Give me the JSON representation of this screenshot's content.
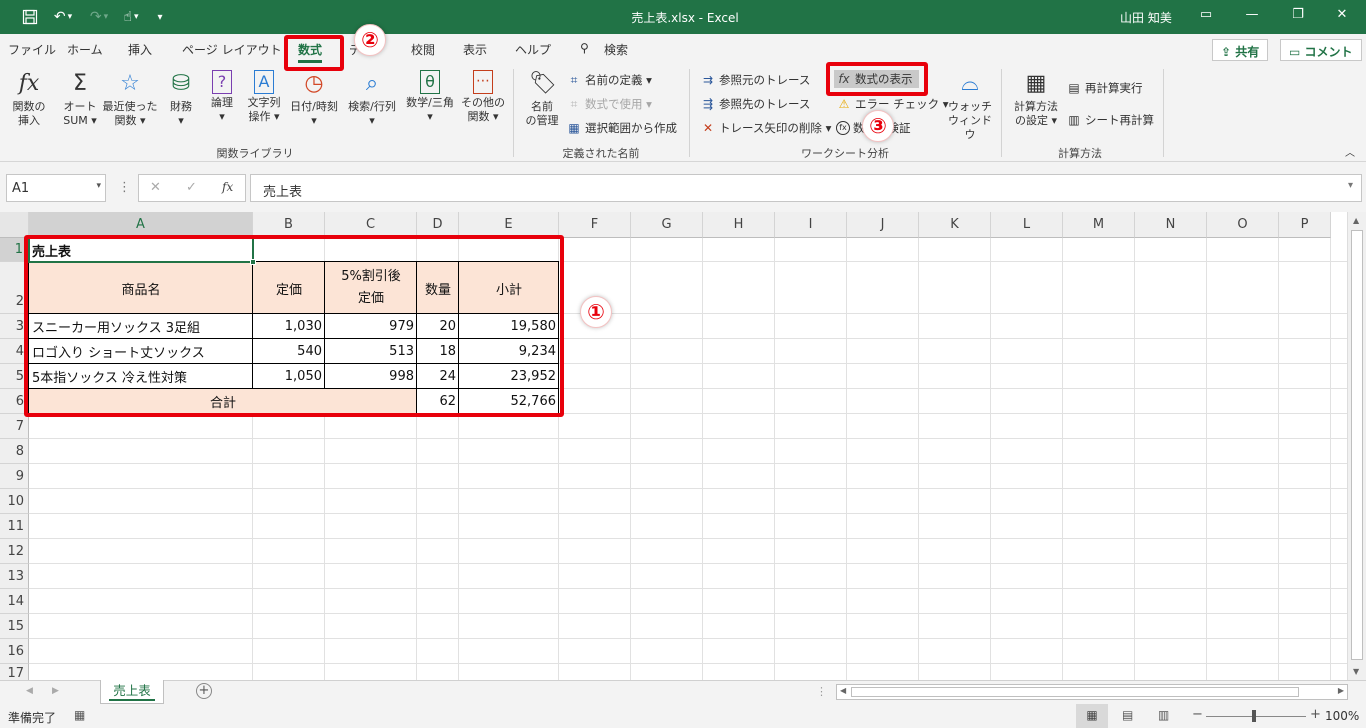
{
  "titlebar": {
    "title": "売上表.xlsx  -  Excel",
    "user": "山田 知美",
    "customize_label": "▾"
  },
  "tabs": [
    "ファイル",
    "ホーム",
    "挿入",
    "ページ レイアウト",
    "数式",
    "データ",
    "校閲",
    "表示",
    "ヘルプ",
    "検索"
  ],
  "active_tab": "数式",
  "share_label": "共有",
  "comment_label": "コメント",
  "badges": [
    "①",
    "②",
    "③"
  ],
  "ribbon": {
    "function_library": {
      "label": "関数ライブラリ",
      "items": [
        {
          "line1": "関数の",
          "line2": "挿入",
          "icon": "fx-icon"
        },
        {
          "line1": "オート",
          "line2": "SUM ▾",
          "icon": "sigma-icon"
        },
        {
          "line1": "最近使った",
          "line2": "関数 ▾",
          "icon": "star-icon"
        },
        {
          "line1": "財務",
          "line2": "▾",
          "icon": "finance-icon"
        },
        {
          "line1": "論理",
          "line2": "▾",
          "icon": "logic-icon"
        },
        {
          "line1": "文字列",
          "line2": "操作 ▾",
          "icon": "text-icon"
        },
        {
          "line1": "日付/時刻",
          "line2": "▾",
          "icon": "clock-icon"
        },
        {
          "line1": "検索/行列",
          "line2": "▾",
          "icon": "lookup-icon"
        },
        {
          "line1": "数学/三角",
          "line2": "▾",
          "icon": "theta-icon"
        },
        {
          "line1": "その他の",
          "line2": "関数 ▾",
          "icon": "more-functions-icon"
        }
      ]
    },
    "defined_names": {
      "label": "定義された名前",
      "name_manager_line1": "名前",
      "name_manager_line2": "の管理",
      "define_name": "名前の定義  ▾",
      "use_in_formula": "数式で使用 ▾",
      "create_from_selection": "選択範囲から作成"
    },
    "formula_auditing": {
      "label": "ワークシート分析",
      "trace_precedents": "参照元のトレース",
      "trace_dependents": "参照先のトレース",
      "remove_arrows": "トレース矢印の削除  ▾",
      "show_formulas": "数式の表示",
      "error_checking": "エラー チェック  ▾",
      "evaluate_formula": "数式の検証",
      "watch_line1": "ウォッチ",
      "watch_line2": "ウィンドウ"
    },
    "calculation": {
      "label": "計算方法",
      "options_line1": "計算方法",
      "options_line2": "の設定 ▾",
      "calc_now": "再計算実行",
      "calc_sheet": "シート再計算"
    }
  },
  "formula_bar": {
    "name_box": "A1",
    "content": "売上表"
  },
  "columns": [
    "A",
    "B",
    "C",
    "D",
    "E",
    "F",
    "G",
    "H",
    "I",
    "J",
    "K",
    "L",
    "M",
    "N",
    "O",
    "P"
  ],
  "rows": [
    "1",
    "2",
    "3",
    "4",
    "5",
    "6",
    "7",
    "8",
    "9",
    "10",
    "11",
    "12",
    "13",
    "14",
    "15",
    "16",
    "17"
  ],
  "sheet": {
    "title": "売上表",
    "headers": {
      "name": "商品名",
      "price": "定価",
      "discount_line1": "5%割引後",
      "discount_line2": "定価",
      "qty": "数量",
      "subtotal": "小計"
    },
    "items": [
      {
        "name": "スニーカー用ソックス 3足組",
        "price": "1,030",
        "discount": "979",
        "qty": "20",
        "subtotal": "19,580"
      },
      {
        "name": "ロゴ入り ショート丈ソックス",
        "price": "540",
        "discount": "513",
        "qty": "18",
        "subtotal": "9,234"
      },
      {
        "name": "5本指ソックス 冷え性対策",
        "price": "1,050",
        "discount": "998",
        "qty": "24",
        "subtotal": "23,952"
      }
    ],
    "total_label": "合計",
    "total_qty": "62",
    "total_subtotal": "52,766"
  },
  "sheet_tab": "売上表",
  "status": {
    "ready": "準備完了",
    "zoom": "100%"
  },
  "colors": {
    "excel_green": "#217346",
    "highlight_red": "#e8000b",
    "header_fill": "#fce4d6"
  }
}
